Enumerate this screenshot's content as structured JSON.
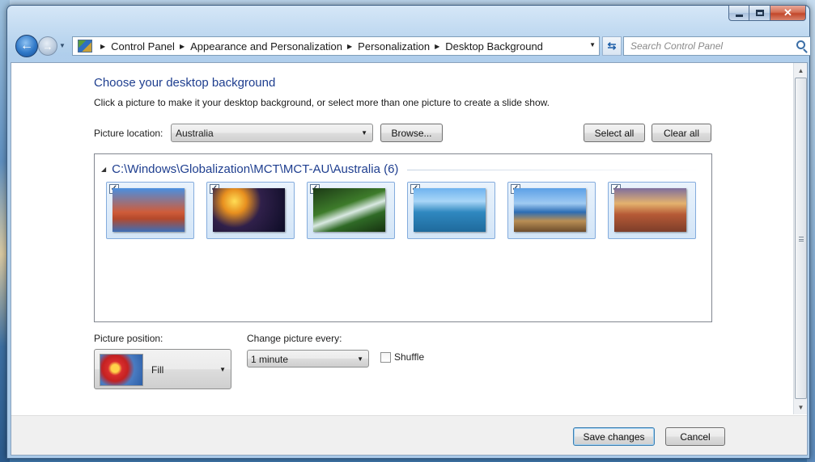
{
  "window": {
    "caption": {
      "minimize": "minimize",
      "maximize": "maximize",
      "close": "✕"
    }
  },
  "nav": {
    "breadcrumbs": [
      "Control Panel",
      "Appearance and Personalization",
      "Personalization",
      "Desktop Background"
    ],
    "search_placeholder": "Search Control Panel"
  },
  "main": {
    "title": "Choose your desktop background",
    "instructions": "Click a picture to make it your desktop background, or select more than one picture to create a slide show.",
    "picture_location_label": "Picture location:",
    "picture_location_value": "Australia",
    "browse_label": "Browse...",
    "select_all_label": "Select all",
    "clear_all_label": "Clear all",
    "gallery": {
      "group_title": "C:\\Windows\\Globalization\\MCT\\MCT-AU\\Australia (6)",
      "pictures": [
        {
          "checked": true
        },
        {
          "checked": true
        },
        {
          "checked": true
        },
        {
          "checked": true
        },
        {
          "checked": true
        },
        {
          "checked": true
        }
      ]
    },
    "picture_position_label": "Picture position:",
    "picture_position_value": "Fill",
    "change_picture_label": "Change picture every:",
    "change_picture_value": "1 minute",
    "shuffle_label": "Shuffle",
    "shuffle_checked": false
  },
  "footer": {
    "save_label": "Save changes",
    "cancel_label": "Cancel"
  },
  "colors": {
    "heading": "#1e3e8f",
    "window_frame": "#b0cfec",
    "close_button": "#c2472a"
  }
}
